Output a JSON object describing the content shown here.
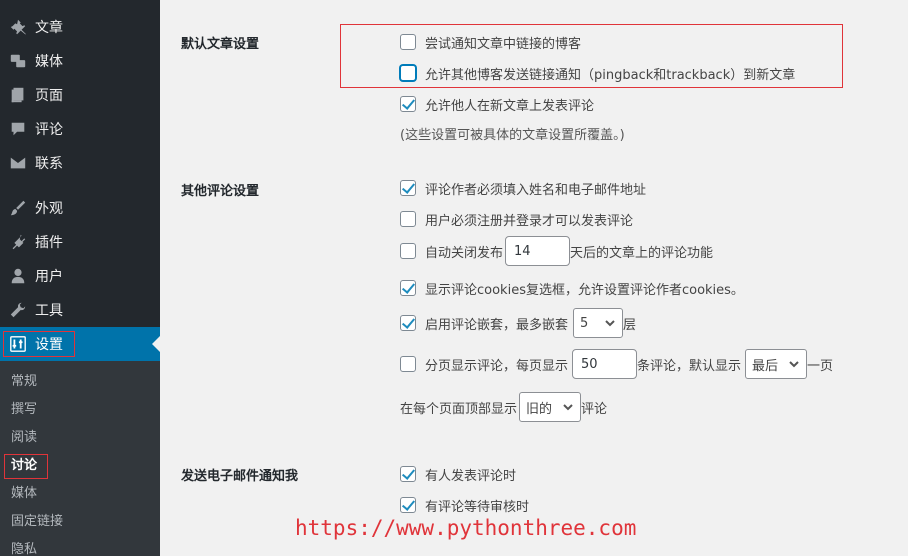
{
  "sidebar": {
    "items": [
      {
        "label": "文章",
        "icon": "pin-icon"
      },
      {
        "label": "媒体",
        "icon": "media-icon"
      },
      {
        "label": "页面",
        "icon": "page-icon"
      },
      {
        "label": "评论",
        "icon": "comment-icon"
      },
      {
        "label": "联系",
        "icon": "mail-icon"
      },
      {
        "label": "外观",
        "icon": "brush-icon"
      },
      {
        "label": "插件",
        "icon": "plugin-icon"
      },
      {
        "label": "用户",
        "icon": "user-icon"
      },
      {
        "label": "工具",
        "icon": "wrench-icon"
      },
      {
        "label": "设置",
        "icon": "settings-icon"
      }
    ],
    "submenu": [
      "常规",
      "撰写",
      "阅读",
      "讨论",
      "媒体",
      "固定链接",
      "隐私"
    ]
  },
  "default_article": {
    "label": "默认文章设置",
    "opt1": "尝试通知文章中链接的博客",
    "opt2": "允许其他博客发送链接通知（pingback和trackback）到新文章",
    "opt3": "允许他人在新文章上发表评论",
    "note": "(这些设置可被具体的文章设置所覆盖。)"
  },
  "other_comment": {
    "label": "其他评论设置",
    "opt1": "评论作者必须填入姓名和电子邮件地址",
    "opt2": "用户必须注册并登录才可以发表评论",
    "opt3_pre": "自动关闭发布",
    "opt3_value": "14",
    "opt3_post": "天后的文章上的评论功能",
    "opt4": "显示评论cookies复选框，允许设置评论作者cookies。",
    "opt5_pre": "启用评论嵌套，最多嵌套",
    "opt5_value": "5",
    "opt5_post": "层",
    "opt6_pre": "分页显示评论，每页显示",
    "opt6_value": "50",
    "opt6_mid": "条评论，默认显示",
    "opt6_select": "最后",
    "opt6_post": "一页",
    "opt7_pre": "在每个页面顶部显示",
    "opt7_select": "旧的",
    "opt7_post": "评论"
  },
  "email_notify": {
    "label": "发送电子邮件通知我",
    "opt1": "有人发表评论时",
    "opt2": "有评论等待审核时"
  },
  "watermark": "https://www.pythonthree.com",
  "colors": {
    "sidebar": "#23282d",
    "active": "#0073aa",
    "highlight": "#e0343a"
  }
}
